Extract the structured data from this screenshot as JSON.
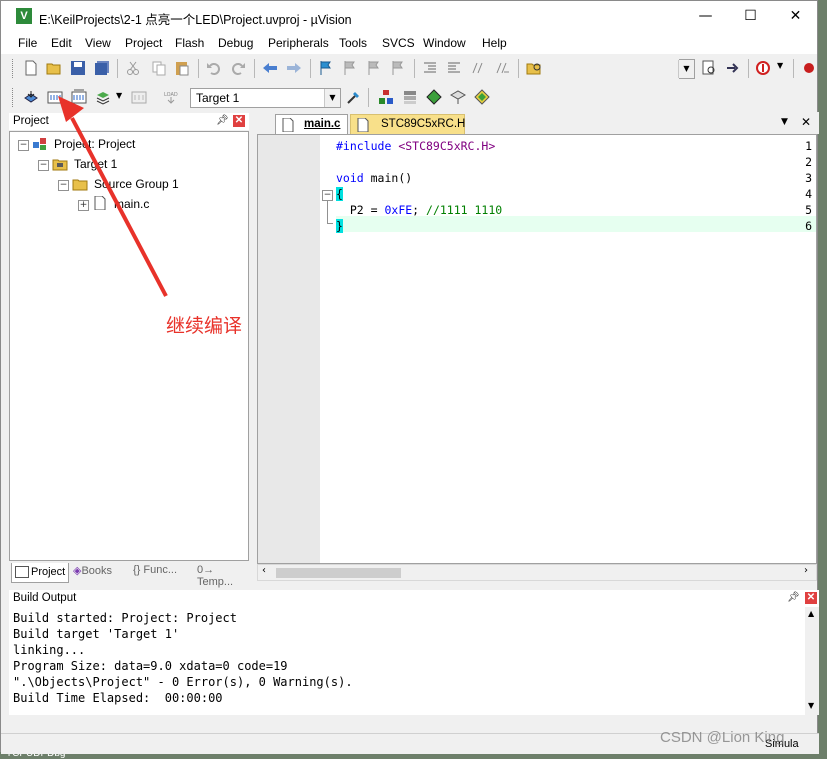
{
  "window": {
    "app_icon": "V",
    "title": "E:\\KeilProjects\\2-1 点亮一个LED\\Project.uvproj - µVision",
    "minimize": "—",
    "maximize": "☐",
    "close": "✕"
  },
  "menu": [
    "File",
    "Edit",
    "View",
    "Project",
    "Flash",
    "Debug",
    "Peripherals",
    "Tools",
    "SVCS",
    "Window",
    "Help"
  ],
  "toolbar2": {
    "target_select": "Target 1"
  },
  "project_pane": {
    "title": "Project",
    "tree": [
      {
        "label": "Project: Project",
        "expander": "−"
      },
      {
        "label": "Target 1",
        "expander": "−"
      },
      {
        "label": "Source Group 1",
        "expander": "−"
      },
      {
        "label": "main.c",
        "expander": "+"
      }
    ],
    "tabs": [
      "Project",
      "Books",
      "{} Func...",
      "0→ Temp..."
    ]
  },
  "editor": {
    "tabs": [
      {
        "label": "main.c",
        "active": true
      },
      {
        "label": "STC89C5xRC.H",
        "active": false
      }
    ],
    "line_numbers": [
      "1",
      "2",
      "3",
      "4",
      "5",
      "6"
    ],
    "lines": [
      {
        "kw": "#include",
        "str": " <STC89C5xRC.H>",
        "rest": ""
      },
      {
        "kw": "",
        "str": "",
        "rest": ""
      },
      {
        "kw": "void",
        "str": "",
        "rest": " main()"
      },
      {
        "kw": "",
        "str": "",
        "rest": "{"
      },
      {
        "kw": "",
        "str": "",
        "rest": "  P2 = ",
        "num": "0xFE",
        "after": ";",
        "comment": " //1111 1110"
      },
      {
        "kw": "",
        "str": "",
        "rest": "}"
      }
    ]
  },
  "annotation": {
    "text": "继续编译",
    "color": "#e8322a"
  },
  "build_output": {
    "title": "Build Output",
    "lines": [
      "Build started: Project: Project",
      "Build target 'Target 1'",
      "linking...",
      "Program Size: data=9.0 xdata=0 code=19",
      "\".\\Objects\\Project\" - 0 Error(s), 0 Warning(s).",
      "Build Time Elapsed:  00:00:00"
    ]
  },
  "status": {
    "right": "Simula"
  },
  "watermark": "CSDN @Lion King",
  "desktop_text": "TCPUDPDbg",
  "colors": {
    "keyword": "#0000ff",
    "string": "#800080",
    "number": "#0000ff",
    "comment": "#008000",
    "current_line": "#e6fff0",
    "brace_match": "#00e0e0"
  }
}
